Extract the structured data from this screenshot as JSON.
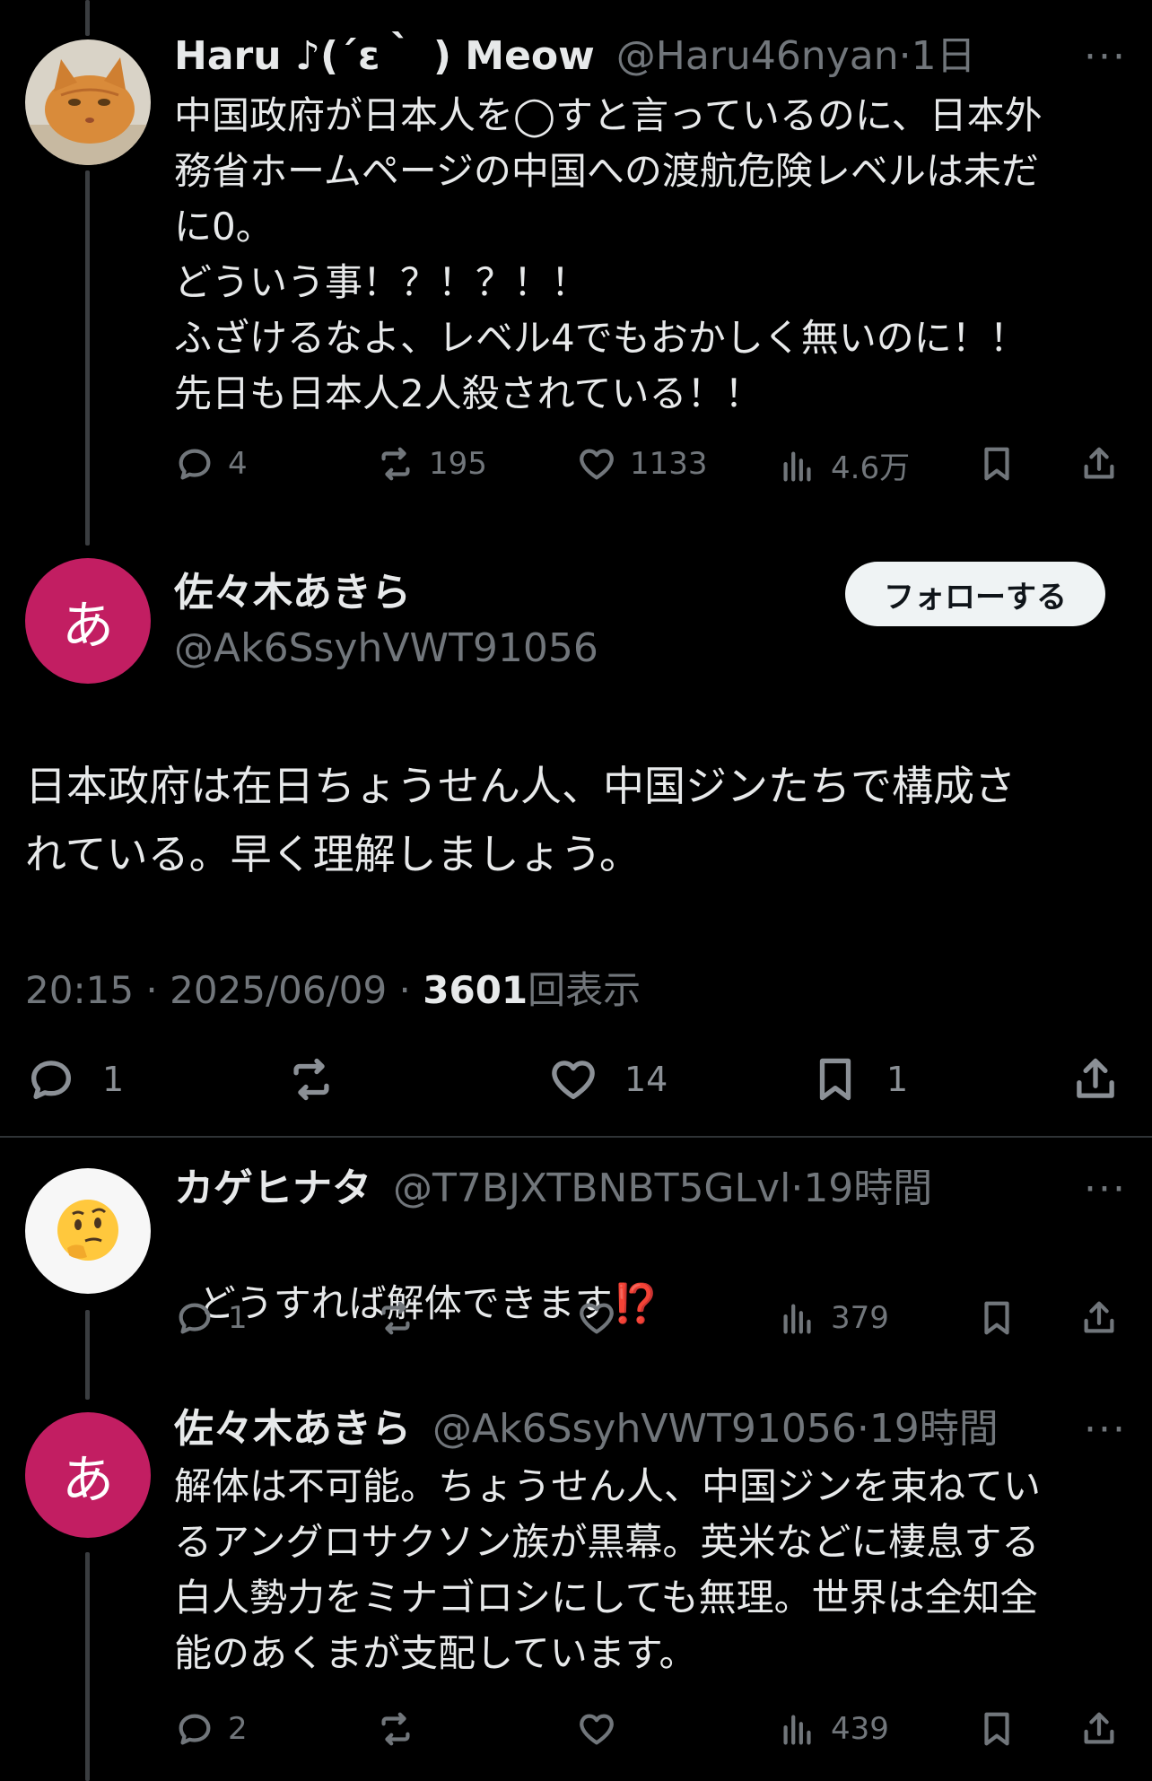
{
  "tweet1": {
    "name": "Haru ♪(´ε｀ ) Meow",
    "handle": "@Haru46nyan",
    "time": "1日",
    "body": "中国政府が日本人を◯すと言っているのに、日本外\n務省ホームページの中国への渡航危険レベルは未だ\nに0。\nどういう事！？！？！！\nふざけるなよ、レベル4でもおかしく無いのに！！\n先日も日本人2人殺されている！！",
    "replies": "4",
    "reposts": "195",
    "likes": "1133",
    "views": "4.6万"
  },
  "main": {
    "avatar_letter": "あ",
    "name": "佐々木あきら",
    "handle": "@Ak6SsyhVWT91056",
    "follow_label": "フォローする",
    "body": "日本政府は在日ちょうせん人、中国ジンたちで構成さ\nれている。早く理解しましょう。",
    "time": "20:15",
    "date": "2025/06/09",
    "views": "3601",
    "views_label": "回表示",
    "replies": "1",
    "likes": "14",
    "bookmarks": "1"
  },
  "reply1": {
    "name": "カゲヒナタ",
    "handle": "@T7BJXTBNBT5GLvl",
    "time": "19時間",
    "body": "どうすれば解体できます",
    "emoji": "⁉️",
    "replies": "1",
    "views": "379"
  },
  "reply2": {
    "avatar_letter": "あ",
    "name": "佐々木あきら",
    "handle": "@Ak6SsyhVWT91056",
    "time": "19時間",
    "body": "解体は不可能。ちょうせん人、中国ジンを束ねてい\nるアングロサクソン族が黒幕。英米などに棲息する\n白人勢力をミナゴロシにしても無理。世界は全知全\n能のあくまが支配しています。",
    "replies": "2",
    "views": "439"
  },
  "icons": {
    "reply": "reply-icon",
    "repost": "repost-icon",
    "like": "heart-icon",
    "views": "views-icon",
    "bookmark": "bookmark-icon",
    "share": "share-icon",
    "more": "more-icon"
  },
  "colors": {
    "background": "#000000",
    "avatar_magenta": "#c21e62",
    "secondary_text": "#71767b"
  }
}
